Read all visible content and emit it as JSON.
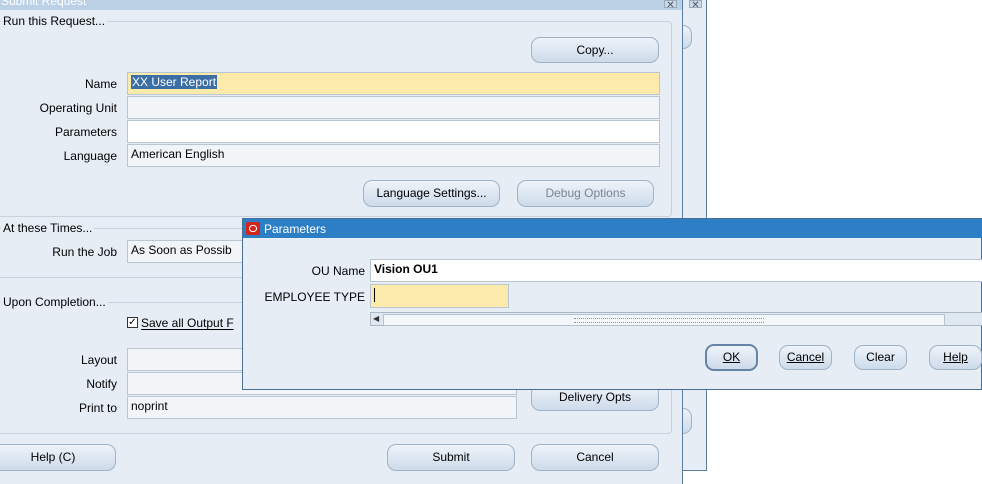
{
  "submit_request": {
    "title": "Submit Request",
    "run_section": {
      "label": "Run this Request...",
      "copy_button": "Copy...",
      "name_label": "Name",
      "name_value": "XX User Report",
      "operating_unit_label": "Operating Unit",
      "operating_unit_value": "",
      "parameters_label": "Parameters",
      "parameters_value": "",
      "language_label": "Language",
      "language_value": "American English",
      "language_settings_button": "Language Settings...",
      "debug_options_button": "Debug Options"
    },
    "times_section": {
      "label": "At these Times...",
      "run_job_label": "Run the Job",
      "run_job_value": "As Soon as Possib"
    },
    "completion_section": {
      "label": "Upon Completion...",
      "save_output_label": "Save all Output F",
      "save_output_checked": true,
      "layout_label": "Layout",
      "notify_label": "Notify",
      "print_to_label": "Print to",
      "print_to_value": "noprint",
      "delivery_opts_button": "Delivery Opts"
    },
    "help_button": "Help (C)",
    "submit_button": "Submit",
    "cancel_button": "Cancel"
  },
  "parameters_dialog": {
    "title": "Parameters",
    "ou_name_label": "OU Name",
    "ou_name_value": "Vision OU1",
    "employee_type_label": "EMPLOYEE TYPE",
    "employee_type_value": "",
    "ok_button": "OK",
    "cancel_button": "Cancel",
    "clear_button": "Clear",
    "help_button": "Help"
  },
  "colors": {
    "window_bg": "#e6edf5",
    "required_field": "#fbeaa9",
    "dialog_title": "#2d7fc5",
    "selection": "#3b6ea5"
  }
}
